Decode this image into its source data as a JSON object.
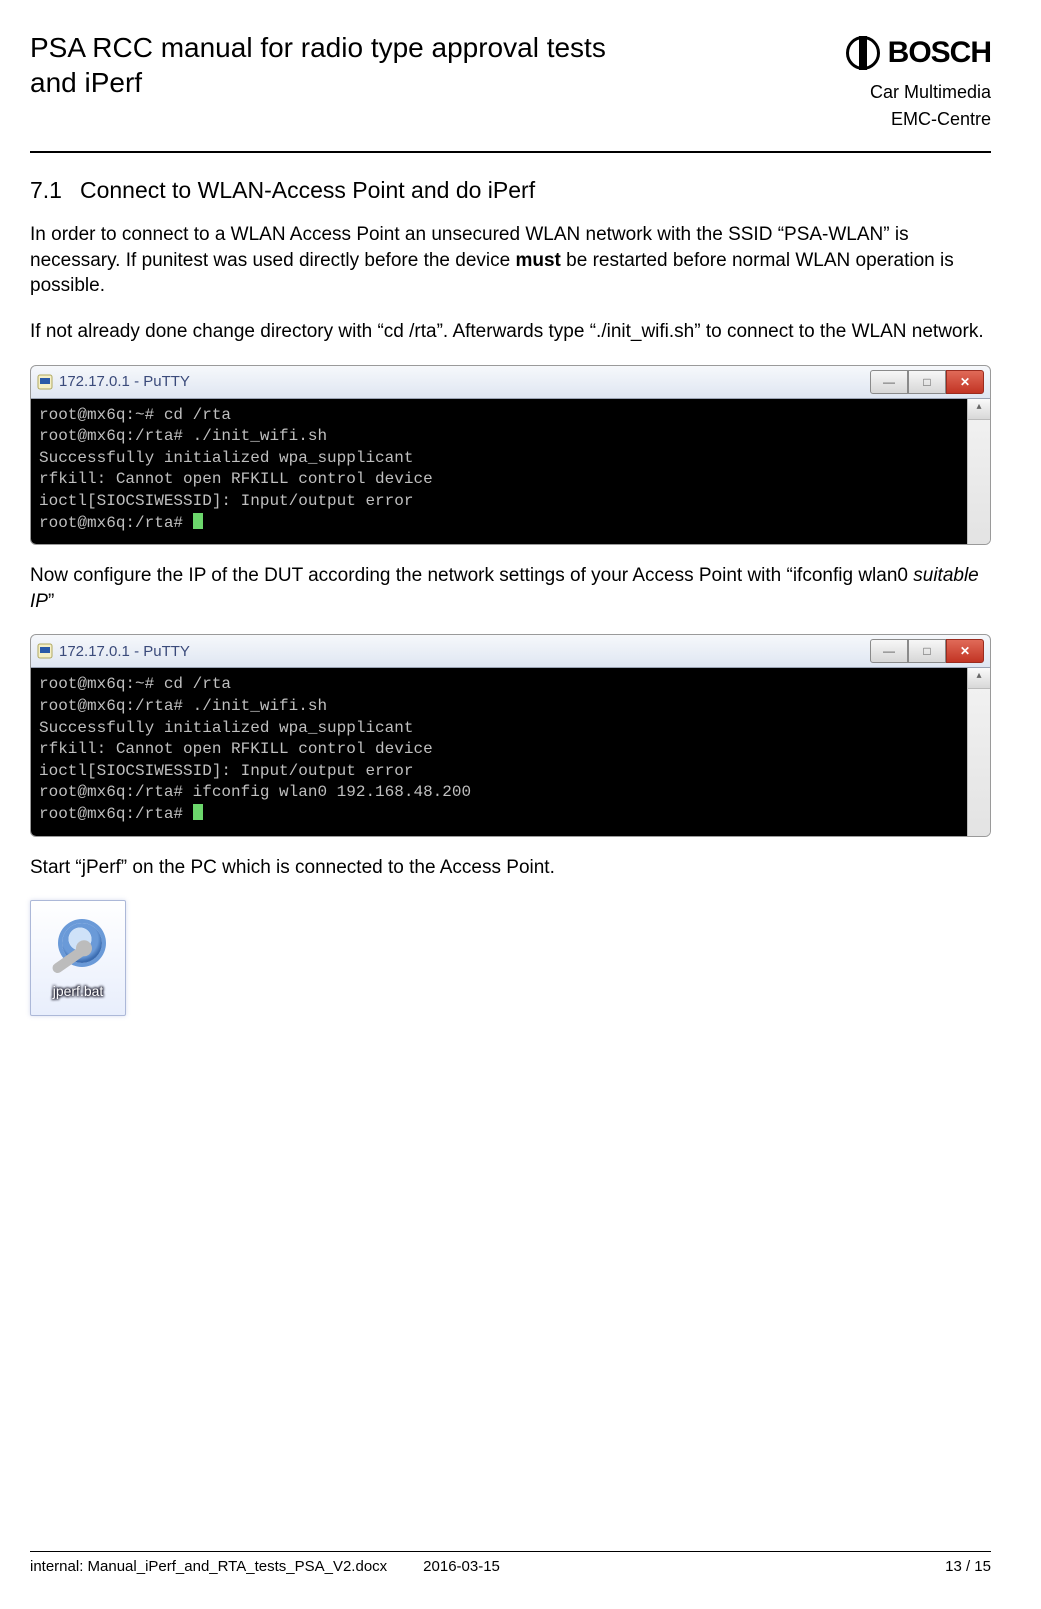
{
  "header": {
    "title": "PSA RCC manual for radio type approval tests and iPerf",
    "brand_word": "BOSCH",
    "subtitle1": "Car Multimedia",
    "subtitle2": "EMC-Centre"
  },
  "section": {
    "number": "7.1",
    "title": "Connect to WLAN-Access Point and do iPerf",
    "p1a": "In order to connect to a WLAN Access Point an unsecured WLAN network with the SSID “PSA-WLAN” is necessary. If punitest was used directly before the device ",
    "p1_bold": "must",
    "p1b": " be restarted before normal WLAN operation is possible.",
    "p2": "If not already done change directory with “cd /rta”. Afterwards type “./init_wifi.sh” to connect to the WLAN network.",
    "p3a": "Now configure the IP of the DUT according the network settings of your Access Point with “ifconfig wlan0 ",
    "p3_italic": "suitable IP",
    "p3b": "”",
    "p4": "Start “jPerf” on the PC which is connected to the Access Point."
  },
  "putty1": {
    "title": "172.17.0.1 - PuTTY",
    "lines": [
      "root@mx6q:~# cd /rta",
      "root@mx6q:/rta# ./init_wifi.sh",
      "Successfully initialized wpa_supplicant",
      "rfkill: Cannot open RFKILL control device",
      "ioctl[SIOCSIWESSID]: Input/output error",
      "root@mx6q:/rta# "
    ]
  },
  "putty2": {
    "title": "172.17.0.1 - PuTTY",
    "lines": [
      "root@mx6q:~# cd /rta",
      "root@mx6q:/rta# ./init_wifi.sh",
      "Successfully initialized wpa_supplicant",
      "rfkill: Cannot open RFKILL control device",
      "ioctl[SIOCSIWESSID]: Input/output error",
      "root@mx6q:/rta# ifconfig wlan0 192.168.48.200",
      "root@mx6q:/rta# "
    ]
  },
  "desktop_icon": {
    "label": "jperf.bat"
  },
  "window_buttons": {
    "min": "—",
    "max": "□",
    "close": "✕"
  },
  "footer": {
    "internal_label": "internal: Manual_iPerf_and_RTA_tests_PSA_V2.docx",
    "date": "2016-03-15",
    "page": "13 / 15"
  }
}
